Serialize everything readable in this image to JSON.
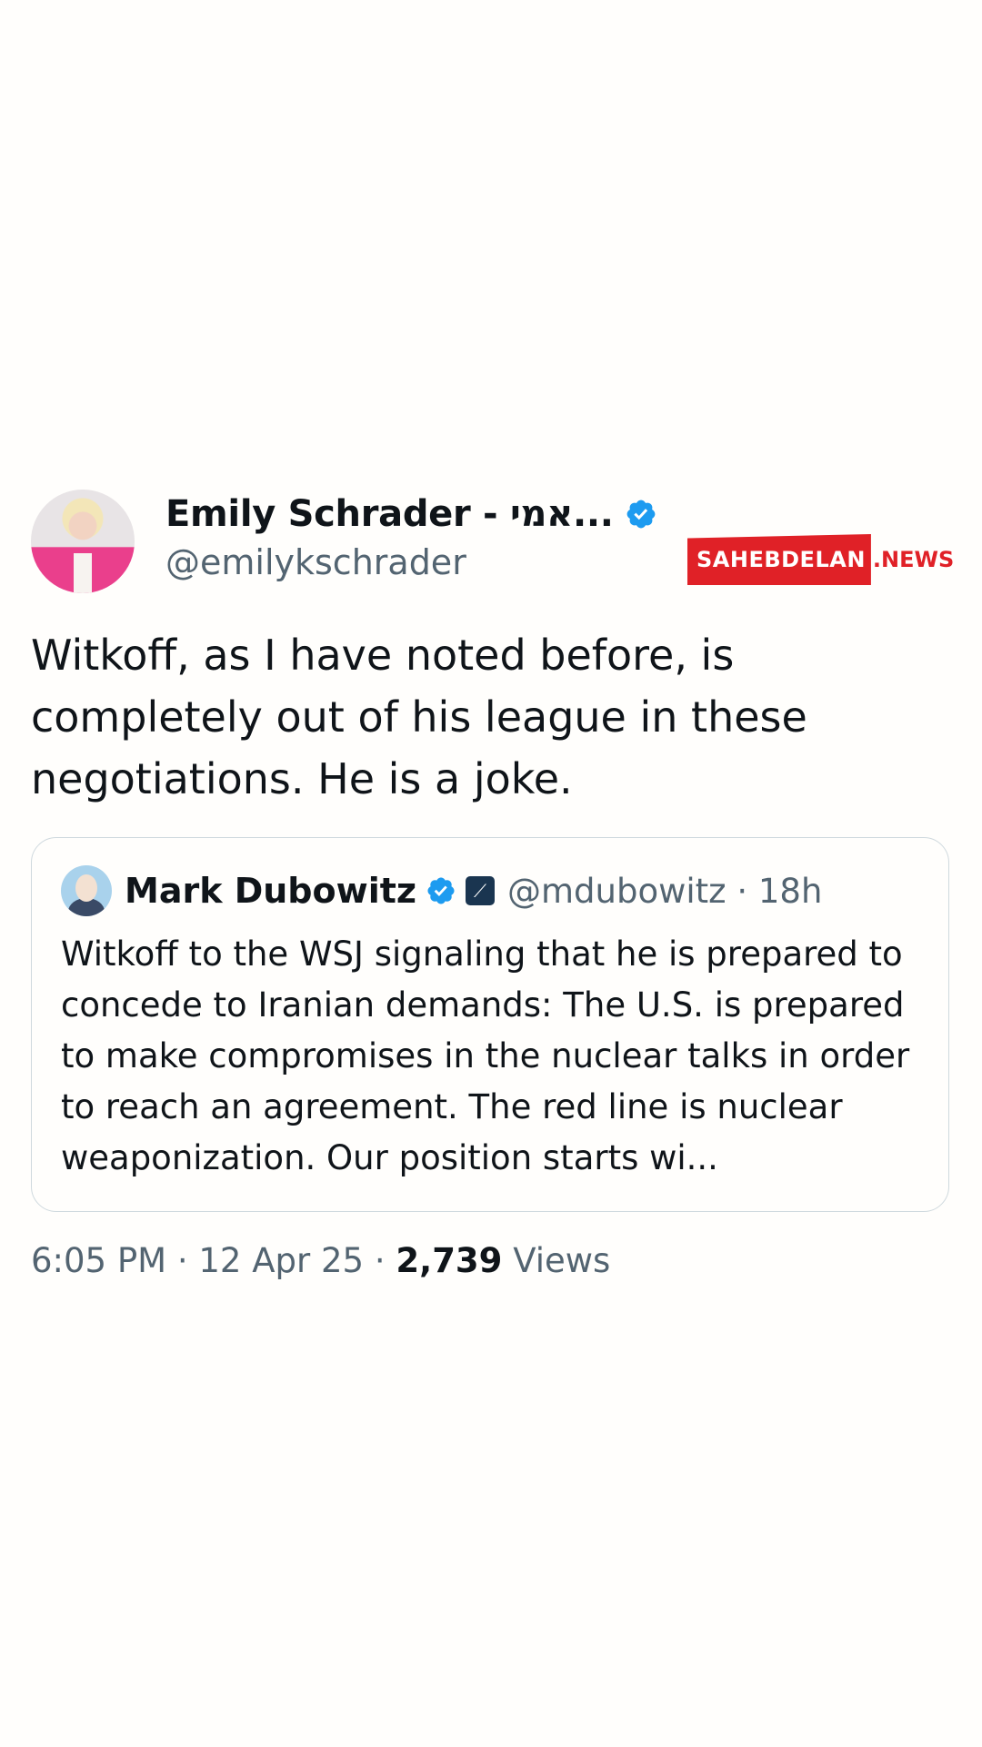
{
  "tweet": {
    "author_name": "Emily Schrader - אמי...",
    "author_handle": "@emilykschrader",
    "text": "Witkoff, as I have noted before, is completely out of his league in these negotiations. He is a joke.",
    "time": "6:05 PM",
    "date": "12 Apr 25",
    "views_count": "2,739",
    "views_label": "Views",
    "separator": "·"
  },
  "quote": {
    "author_name": "Mark Dubowitz",
    "author_handle": "@mdubowitz",
    "separator": "·",
    "age": "18h",
    "text": "Witkoff to the WSJ signaling that he is prepared to concede to Iranian demands: The U.S. is prepared to make compromises in the nuclear talks in order to reach an agreement. The red line is nuclear weaponization. Our position starts wi..."
  },
  "watermark": {
    "brand": "SAHEBDELAN",
    "suffix": ".NEWS"
  },
  "colors": {
    "verified": "#1d9bf0",
    "secondary_text": "#536471",
    "watermark_red": "#e02127"
  },
  "icons": [
    "verified-badge-icon",
    "affiliate-badge-icon"
  ]
}
